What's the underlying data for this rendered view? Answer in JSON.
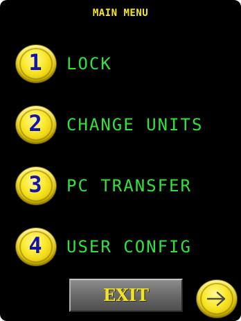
{
  "header": {
    "title": "MAIN MENU"
  },
  "menu": {
    "items": [
      {
        "number": "1",
        "label": "LOCK"
      },
      {
        "number": "2",
        "label": "CHANGE UNITS"
      },
      {
        "number": "3",
        "label": "PC TRANSFER"
      },
      {
        "number": "4",
        "label": "USER CONFIG"
      }
    ]
  },
  "footer": {
    "exit_label": "EXIT",
    "next_icon": "arrow-right-icon"
  },
  "colors": {
    "background": "#000000",
    "title": "#f5e62a",
    "label": "#32e23c",
    "number": "#1414a8",
    "button_yellow": "#fbea31",
    "exit_gray": "#6a6a6a"
  }
}
